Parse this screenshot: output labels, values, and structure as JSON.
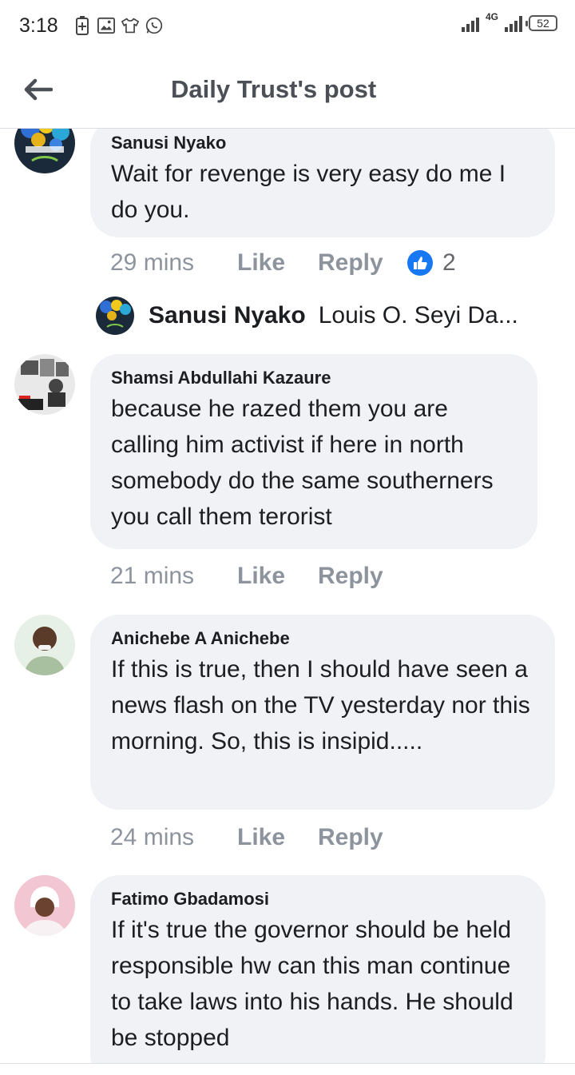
{
  "status_bar": {
    "time": "3:18",
    "network": "4G",
    "battery": "52",
    "left_icons": [
      "battery-saver-icon",
      "gallery-icon",
      "shirt-icon",
      "whatsapp-icon"
    ]
  },
  "header": {
    "title": "Daily Trust's post",
    "back_icon": "arrow-left-icon"
  },
  "comments": [
    {
      "author": "Sanusi Nyako",
      "text": "Wait for revenge is very easy do me I do you.",
      "time": "29 mins",
      "like_label": "Like",
      "reply_label": "Reply",
      "reaction_count": "2",
      "reply_preview": {
        "author": "Sanusi Nyako",
        "snippet": "Louis O. Seyi Da..."
      }
    },
    {
      "author": "Shamsi Abdullahi Kazaure",
      "text": "because he razed them you are calling him activist if here in north somebody do the same southerners you call them terorist",
      "time": "21 mins",
      "like_label": "Like",
      "reply_label": "Reply"
    },
    {
      "author": "Anichebe A Anichebe",
      "text": "If this is true, then I should have seen a news flash on the TV yesterday nor this morning. So, this is insipid.....",
      "time": "24 mins",
      "like_label": "Like",
      "reply_label": "Reply"
    },
    {
      "author": "Fatimo Gbadamosi",
      "text": "If it's true the governor should be held responsible hw can this man continue to take laws into his hands. He should be stopped"
    }
  ],
  "colors": {
    "bubble": "#f0f2f5",
    "meta_text": "#8d949e",
    "like_blue": "#1877f2",
    "title_text": "#4b4f56"
  }
}
